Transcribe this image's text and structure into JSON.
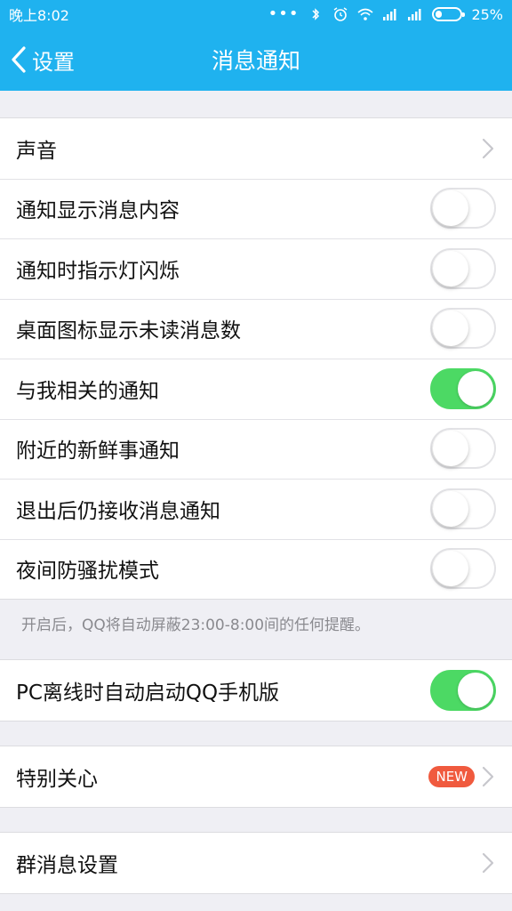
{
  "status_bar": {
    "time": "晚上8:02",
    "dots": "•••",
    "battery": "25%"
  },
  "nav": {
    "back_label": "设置",
    "title": "消息通知"
  },
  "group1": {
    "items": [
      {
        "label": "声音",
        "type": "chevron"
      },
      {
        "label": "通知显示消息内容",
        "type": "switch",
        "on": false
      },
      {
        "label": "通知时指示灯闪烁",
        "type": "switch",
        "on": false
      },
      {
        "label": "桌面图标显示未读消息数",
        "type": "switch",
        "on": false
      },
      {
        "label": "与我相关的通知",
        "type": "switch",
        "on": true
      },
      {
        "label": "附近的新鲜事通知",
        "type": "switch",
        "on": false
      },
      {
        "label": "退出后仍接收消息通知",
        "type": "switch",
        "on": false
      },
      {
        "label": "夜间防骚扰模式",
        "type": "switch",
        "on": false
      }
    ]
  },
  "hint": "开启后，QQ将自动屏蔽23:00-8:00间的任何提醒。",
  "group2": {
    "label": "PC离线时自动启动QQ手机版",
    "on": true
  },
  "group3": {
    "label": "特别关心",
    "badge": "NEW"
  },
  "group4": {
    "label": "群消息设置"
  },
  "colors": {
    "accent": "#1fb2ef",
    "switch_on": "#4cd964",
    "badge": "#f05a3e"
  }
}
